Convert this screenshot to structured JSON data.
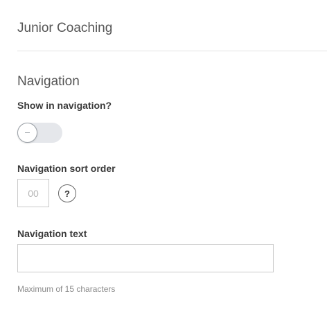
{
  "page": {
    "title": "Junior Coaching"
  },
  "navigation": {
    "heading": "Navigation",
    "show_in_navigation": {
      "label": "Show in navigation?",
      "enabled": false
    },
    "sort_order": {
      "label": "Navigation sort order",
      "placeholder": "00",
      "value": "",
      "help_icon": "question-mark-icon"
    },
    "nav_text": {
      "label": "Navigation text",
      "placeholder": "",
      "value": "",
      "hint": "Maximum of 15 characters"
    }
  },
  "colors": {
    "toggle_track": "#e5e7eb",
    "toggle_knob_border": "#9aa0a6",
    "input_border": "#c9c9c9",
    "hint_text": "#8a8a8a"
  }
}
